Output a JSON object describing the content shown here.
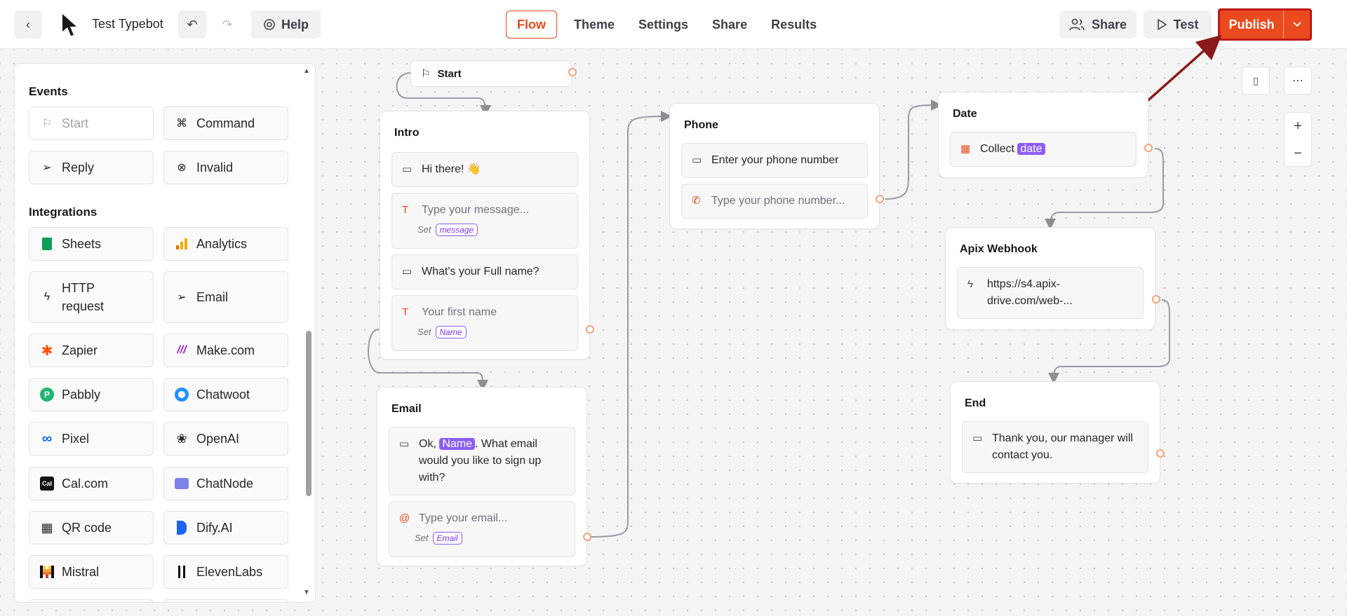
{
  "header": {
    "bot_name": "Test Typebot",
    "help_label": "Help",
    "tabs": [
      {
        "label": "Flow",
        "active": true
      },
      {
        "label": "Theme",
        "active": false
      },
      {
        "label": "Settings",
        "active": false
      },
      {
        "label": "Share",
        "active": false
      },
      {
        "label": "Results",
        "active": false
      }
    ],
    "share_label": "Share",
    "test_label": "Test",
    "publish_label": "Publish"
  },
  "sidebar": {
    "events_title": "Events",
    "events": [
      {
        "label": "Start",
        "icon": "flag-icon",
        "disabled": true
      },
      {
        "label": "Command",
        "icon": "command-icon"
      },
      {
        "label": "Reply",
        "icon": "send-icon"
      },
      {
        "label": "Invalid",
        "icon": "x-circle-icon"
      }
    ],
    "integrations_title": "Integrations",
    "integrations": [
      {
        "label": "Sheets",
        "icon": "sheets-icon"
      },
      {
        "label": "Analytics",
        "icon": "analytics-icon"
      },
      {
        "label": "HTTP request",
        "icon": "bolt-icon"
      },
      {
        "label": "Email",
        "icon": "send-icon"
      },
      {
        "label": "Zapier",
        "icon": "zapier-icon"
      },
      {
        "label": "Make.com",
        "icon": "make-icon"
      },
      {
        "label": "Pabbly",
        "icon": "pabbly-icon"
      },
      {
        "label": "Chatwoot",
        "icon": "chatwoot-icon"
      },
      {
        "label": "Pixel",
        "icon": "meta-icon"
      },
      {
        "label": "OpenAI",
        "icon": "openai-icon"
      },
      {
        "label": "Cal.com",
        "icon": "calcom-icon"
      },
      {
        "label": "ChatNode",
        "icon": "chatnode-icon"
      },
      {
        "label": "QR code",
        "icon": "qr-icon"
      },
      {
        "label": "Dify.AI",
        "icon": "dify-icon"
      },
      {
        "label": "Mistral",
        "icon": "mistral-icon"
      },
      {
        "label": "ElevenLabs",
        "icon": "elevenlabs-icon"
      }
    ]
  },
  "canvas": {
    "start_label": "Start",
    "intro": {
      "title": "Intro",
      "msg1": "Hi there! 👋",
      "input1_placeholder": "Type your message...",
      "set_label": "Set",
      "input1_var": "message",
      "msg2": "What's your Full name?",
      "input2_placeholder": "Your first name",
      "input2_var": "Name"
    },
    "email": {
      "title": "Email",
      "msg_prefix": "Ok, ",
      "msg_var": "Name",
      "msg_suffix": ". What email would you like to sign up with?",
      "input_placeholder": "Type your email...",
      "set_label": "Set",
      "input_var": "Email"
    },
    "phone": {
      "title": "Phone",
      "msg": "Enter your phone number",
      "input_placeholder": "Type your phone number..."
    },
    "date": {
      "title": "Date",
      "collect_label": "Collect",
      "collect_var": "date"
    },
    "webhook": {
      "title": "Apix Webhook",
      "url": "https://s4.apix-drive.com/web-..."
    },
    "end": {
      "title": "End",
      "msg": "Thank you, our manager will contact you."
    }
  },
  "colors": {
    "accent": "#ea4a1d",
    "highlight_border": "#c0161a",
    "variable": "#8b5cf6",
    "arrow": "#8b1a1a"
  }
}
